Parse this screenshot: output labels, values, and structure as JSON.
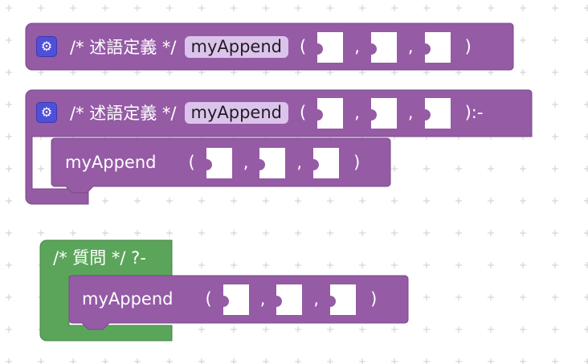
{
  "colors": {
    "purple": "#955ba5",
    "purple_dark": "#7a4889",
    "green": "#5ba55b",
    "green_dark": "#468446",
    "pill_bg": "#dcc3ec",
    "gear_bg": "#4f4fd9"
  },
  "blocks": {
    "def1": {
      "icon": "gear-icon",
      "comment": "/* 述語定義 */",
      "name": "myAppend",
      "open": "(",
      "sep1": ",",
      "sep2": ",",
      "close": ")"
    },
    "def2": {
      "icon": "gear-icon",
      "comment": "/* 述語定義 */",
      "name": "myAppend",
      "open": "(",
      "sep1": ",",
      "sep2": ",",
      "close": "):-",
      "body": {
        "name": "myAppend",
        "open": "(",
        "sep1": ",",
        "sep2": ",",
        "close": ")"
      }
    },
    "query": {
      "comment": "/* 質問 */ ?-",
      "body": {
        "name": "myAppend",
        "open": "(",
        "sep1": ",",
        "sep2": ",",
        "close": ")"
      }
    }
  }
}
